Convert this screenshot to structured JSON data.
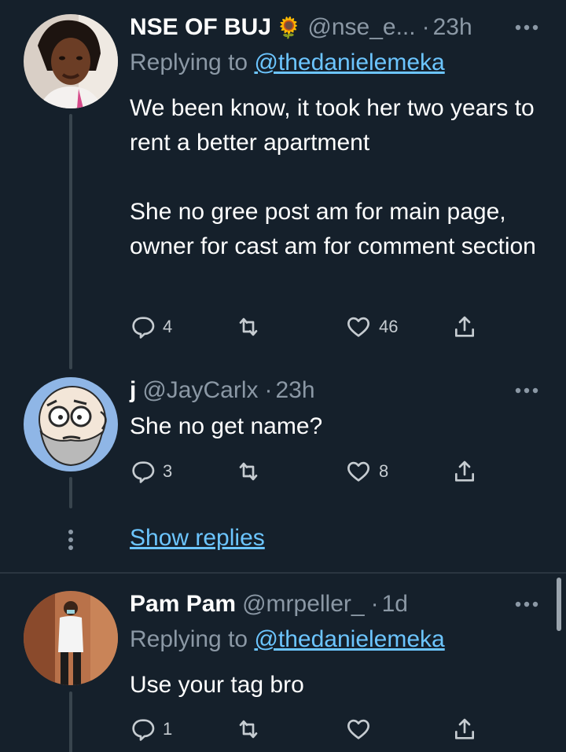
{
  "tweets": [
    {
      "name": "NSE OF BUJ",
      "emoji": "🌻",
      "handle": "@nse_e...",
      "time": "23h",
      "reply_prefix": "Replying to ",
      "reply_handle": "@thedanielemeka",
      "text1": "We been know, it took her two years to rent a better apartment",
      "text2": "She no gree post am for main page, owner for cast am for comment section",
      "replies": "4",
      "retweets": "",
      "likes": "46"
    },
    {
      "name": "j",
      "handle": "@JayCarlx",
      "time": "23h",
      "text1": "She no get name?",
      "replies": "3",
      "retweets": "",
      "likes": "8"
    },
    {
      "name": "Pam Pam",
      "handle": "@mrpeller_",
      "time": "1d",
      "reply_prefix": "Replying to ",
      "reply_handle": "@thedanielemeka",
      "text1": "Use your tag bro",
      "replies": "1",
      "retweets": "",
      "likes": ""
    }
  ],
  "show_replies": "Show replies",
  "icons": {
    "reply": "reply-icon",
    "retweet": "retweet-icon",
    "like": "heart-icon",
    "share": "share-icon",
    "more": "more-icon"
  },
  "colors": {
    "background": "#15202b",
    "link": "#6cc5ff",
    "muted": "#8b98a5"
  }
}
